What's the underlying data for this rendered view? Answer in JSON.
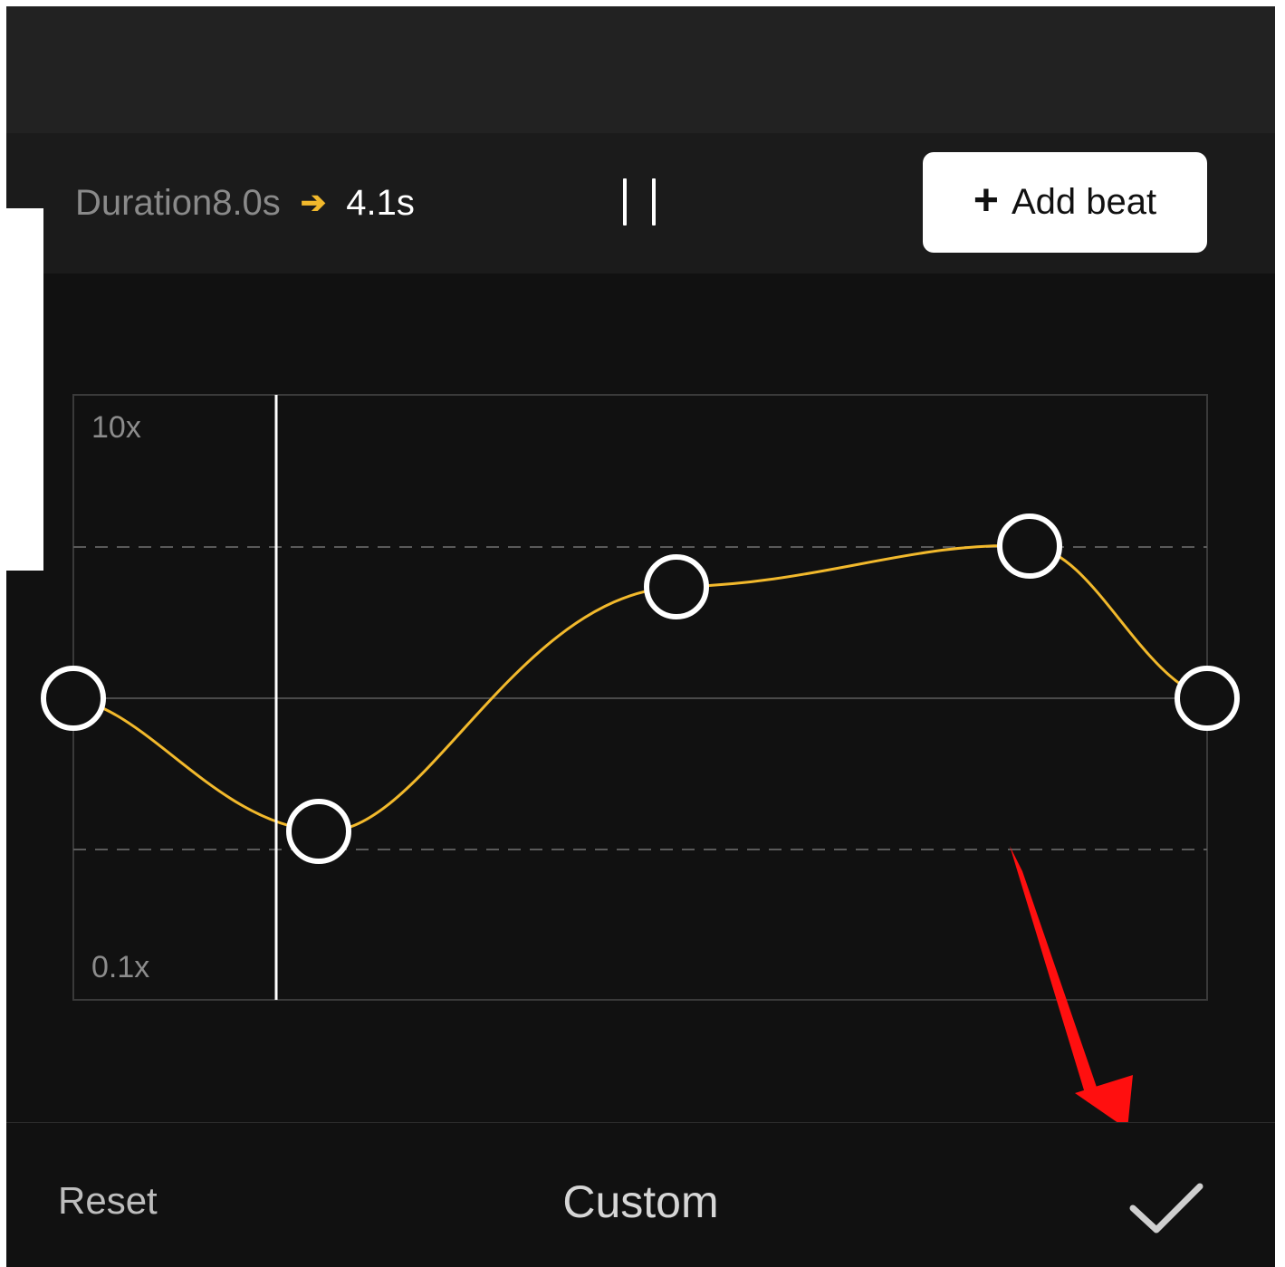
{
  "header": {
    "duration_label": "Duration8.0s",
    "arrow_glyph": "➔",
    "new_duration": "4.1s",
    "add_beat_plus": "+",
    "add_beat_label": "Add beat"
  },
  "graph": {
    "y_max_label": "10x",
    "y_min_label": "0.1x",
    "curve_color": "#f2b92c"
  },
  "footer": {
    "reset_label": "Reset",
    "mode_label": "Custom"
  },
  "colors": {
    "background": "#111111",
    "header_background": "#1b1b1b",
    "accent": "#f2b92c",
    "annotation_arrow": "#ff0000"
  },
  "icons": {
    "pause": "pause-icon",
    "plus": "plus-icon",
    "confirm": "checkmark-icon",
    "annotation": "red-arrow-annotation"
  }
}
